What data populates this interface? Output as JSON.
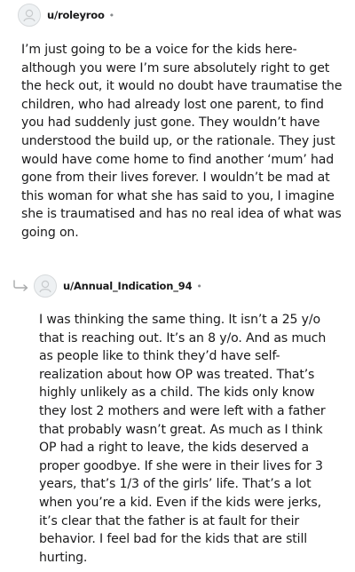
{
  "comments": [
    {
      "username": "u/roleyroo",
      "separator": "•",
      "avatar_icon": "default-avatar-icon",
      "body": "I’m just going to be a voice for the kids here- although you were I’m sure absolutely right to get the heck out, it would no doubt have traumatise the children, who had already lost one parent, to find you had suddenly just gone. They wouldn’t have understood the build up, or the rationale. They just would have come home to find another ‘mum’ had gone from their lives forever. I wouldn’t be mad at this woman for what she has said to you, I imagine she is traumatised and has no real idea of what was going on."
    },
    {
      "username": "u/Annual_Indication_94",
      "separator": "•",
      "avatar_icon": "default-avatar-icon",
      "reply_icon": "reply-arrow-icon",
      "body": "I was thinking the same thing. It isn’t a 25 y/o that is reaching out. It’s an 8 y/o. And as much as people like to think they’d have self-realization about how OP was treated. That’s highly unlikely as a child. The kids only know they lost 2 mothers and were left with a father that probably wasn’t great. As much as I think OP had a right to leave, the kids deserved a proper goodbye. If she were in their lives for 3 years, that’s 1/3 of the girls’ life. That’s a lot when you’re a kid. Even if the kids were jerks, it’s clear that the father is at fault for their behavior. I feel bad for the kids that are still hurting."
    }
  ],
  "colors": {
    "text": "#1a1a1b",
    "meta": "#878a8c",
    "avatar_bg": "#eef1f3",
    "avatar_border": "#d7dadc",
    "reply_arrow": "#a8aaab"
  }
}
